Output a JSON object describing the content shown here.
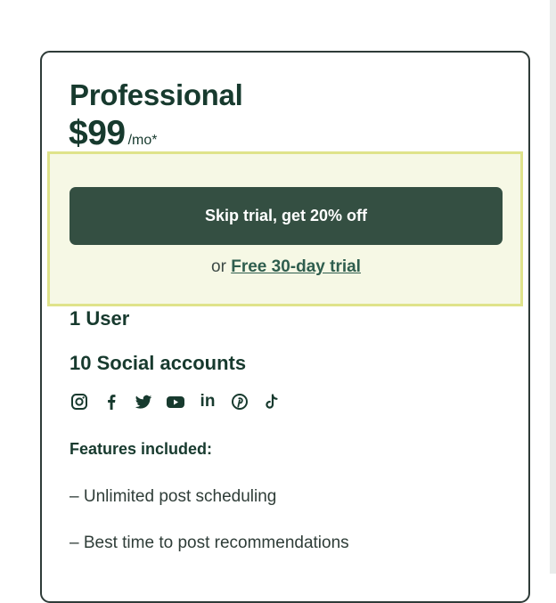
{
  "plan": {
    "name": "Professional",
    "price": "$99",
    "price_suffix": "/mo*"
  },
  "cta": {
    "button_label": "Skip trial, get 20% off",
    "alt_prefix": "or",
    "alt_link": "Free 30-day trial"
  },
  "limits": {
    "users": "1 User",
    "social_accounts": "10 Social accounts"
  },
  "social_icons": [
    "instagram-icon",
    "facebook-icon",
    "twitter-icon",
    "youtube-icon",
    "linkedin-icon",
    "pinterest-icon",
    "tiktok-icon"
  ],
  "features": {
    "title": "Features included:",
    "items": [
      "– Unlimited post scheduling",
      "– Best time to post recommendations"
    ]
  },
  "colors": {
    "primary": "#344f42",
    "text": "#173a2e",
    "highlight_bg": "#f6f8e5",
    "highlight_border": "#dfe38a"
  }
}
